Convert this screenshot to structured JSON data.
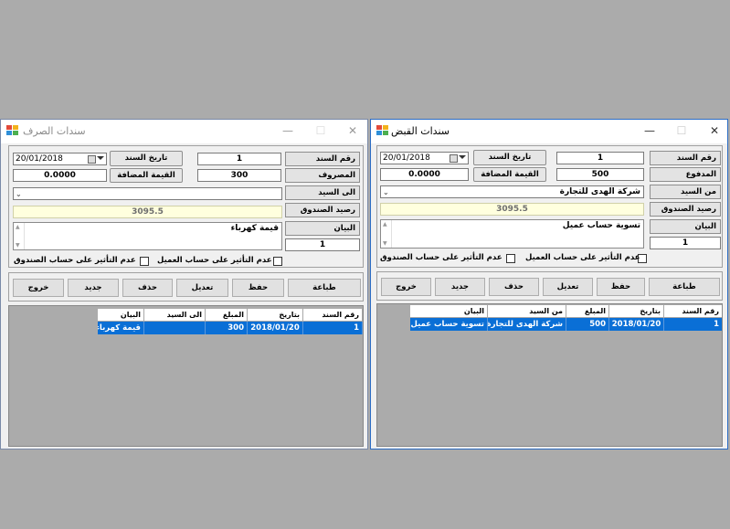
{
  "payment_window": {
    "title": "سندات الصرف",
    "voucher_no_label": "رقم السند",
    "voucher_no": "1",
    "voucher_date_label": "تاريخ السند",
    "voucher_date": "20/01/2018",
    "expense_label": "المصروف",
    "expense_amount": "300",
    "added_value_label": "القيمة المضافة",
    "added_value": "0.0000",
    "to_label": "الى السيد",
    "to_value": "",
    "fund_balance_label": "رصيد الصندوق",
    "fund_balance": "3095.5",
    "statement_label": "البيان",
    "statement": "قيمة كهرباء",
    "statement_count": "1",
    "no_effect_fund_label": "عدم التأثير على حساب الصندوق",
    "no_effect_client_label": "عدم التأثير على حساب العميل",
    "buttons": {
      "print": "طباعة",
      "save": "حفظ",
      "edit": "تعديل",
      "delete": "حذف",
      "new": "جديد",
      "exit": "خروج"
    },
    "table": {
      "headers": [
        "رقم السند",
        "بتاريخ",
        "المبلغ",
        "الى السيد",
        "البيان"
      ],
      "rows": [
        [
          "1",
          "2018/01/20",
          "300",
          "",
          "قيمة كهرباء"
        ]
      ]
    }
  },
  "receipt_window": {
    "title": "سندات القبض",
    "voucher_no_label": "رقم السند",
    "voucher_no": "1",
    "voucher_date_label": "تاريخ السند",
    "voucher_date": "20/01/2018",
    "paid_label": "المدفوع",
    "paid_amount": "500",
    "added_value_label": "القيمة المضافة",
    "added_value": "0.0000",
    "from_label": "من السيد",
    "from_value": "شركة الهدى للتجارة",
    "fund_balance_label": "رصيد الصندوق",
    "fund_balance": "3095.5",
    "statement_label": "البيان",
    "statement": "تسوية حساب عميل",
    "statement_count": "1",
    "no_effect_fund_label": "عدم التأثير على حساب الصندوق",
    "no_effect_client_label": "عدم التأثير على حساب العميل",
    "buttons": {
      "print": "طباعة",
      "save": "حفظ",
      "edit": "تعديل",
      "delete": "حذف",
      "new": "جديد",
      "exit": "خروج"
    },
    "table": {
      "headers": [
        "رقم السند",
        "بتاريخ",
        "المبلغ",
        "من السيد",
        "البيان"
      ],
      "rows": [
        [
          "1",
          "2018/01/20",
          "500",
          "شركة الهدى للتجارة",
          "تسوية حساب عميل"
        ]
      ]
    }
  },
  "window_controls": {
    "minimize": "—",
    "maximize": "☐",
    "close": "✕"
  },
  "colors": {
    "selection": "#0a6fd6",
    "active_border": "#2b6cc4",
    "balance_bg": "#ffffde"
  }
}
